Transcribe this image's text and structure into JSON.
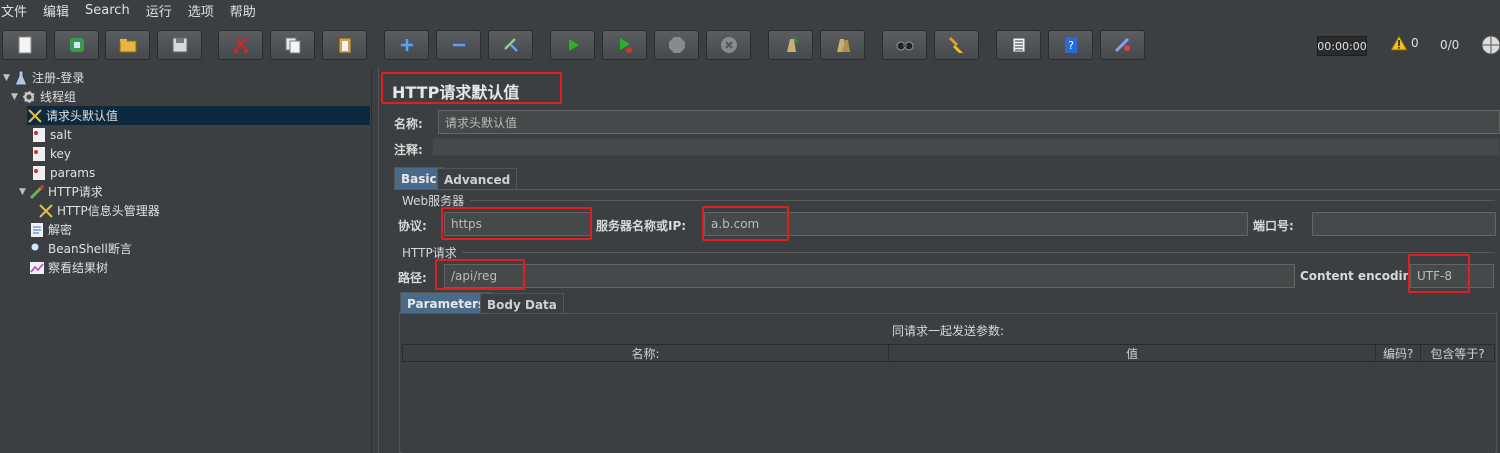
{
  "menu": [
    "文件",
    "编辑",
    "Search",
    "运行",
    "选项",
    "帮助"
  ],
  "toolbar": {
    "buttons": [
      "new-icon",
      "templates-icon",
      "open-icon",
      "save-icon",
      "cut-icon",
      "copy-icon",
      "paste-icon",
      "add-icon",
      "remove-icon",
      "toggle-icon",
      "start-icon",
      "start-no-pause-icon",
      "stop-icon",
      "shutdown-icon",
      "clear-icon",
      "clear-all-icon",
      "search-icon",
      "reset-search-icon",
      "function-helper-icon",
      "help-icon",
      "remote-icon"
    ],
    "timer": "00:00:00",
    "warning_count": "0",
    "threads": "0/0"
  },
  "tree": {
    "items": [
      {
        "label": "注册-登录",
        "icon": "test-plan-icon"
      },
      {
        "label": "线程组",
        "icon": "thread-group-icon"
      },
      {
        "label": "请求头默认值",
        "icon": "config-element-icon"
      },
      {
        "label": "salt",
        "icon": "variable-icon"
      },
      {
        "label": "key",
        "icon": "variable-icon"
      },
      {
        "label": "params",
        "icon": "variable-icon"
      },
      {
        "label": "HTTP请求",
        "icon": "sampler-icon"
      },
      {
        "label": "HTTP信息头管理器",
        "icon": "config-element-icon"
      },
      {
        "label": "解密",
        "icon": "preprocessor-icon"
      },
      {
        "label": "BeanShell断言",
        "icon": "assertion-icon"
      },
      {
        "label": "察看结果树",
        "icon": "listener-icon"
      }
    ]
  },
  "panel": {
    "title": "HTTP请求默认值",
    "name_label": "名称:",
    "name_value": "请求头默认值",
    "comment_label": "注释:",
    "tabs": [
      "Basic",
      "Advanced"
    ],
    "web_server_group": "Web服务器",
    "protocol_label": "协议:",
    "protocol_value": "https",
    "server_label": "服务器名称或IP:",
    "server_value": "a.b.com",
    "port_label": "端口号:",
    "port_value": "",
    "http_request_group": "HTTP请求",
    "path_label": "路径:",
    "path_value": "/api/reg",
    "encoding_label": "Content encoding:",
    "encoding_value": "UTF-8",
    "sub_tabs": [
      "Parameters",
      "Body Data"
    ],
    "params_caption": "同请求一起发送参数:",
    "columns": [
      "名称:",
      "值",
      "编码?",
      "包含等于?"
    ]
  },
  "colors": {
    "highlight_box": "#e02020",
    "selection": "#0d293e",
    "active_tab": "#4a6a8a"
  }
}
